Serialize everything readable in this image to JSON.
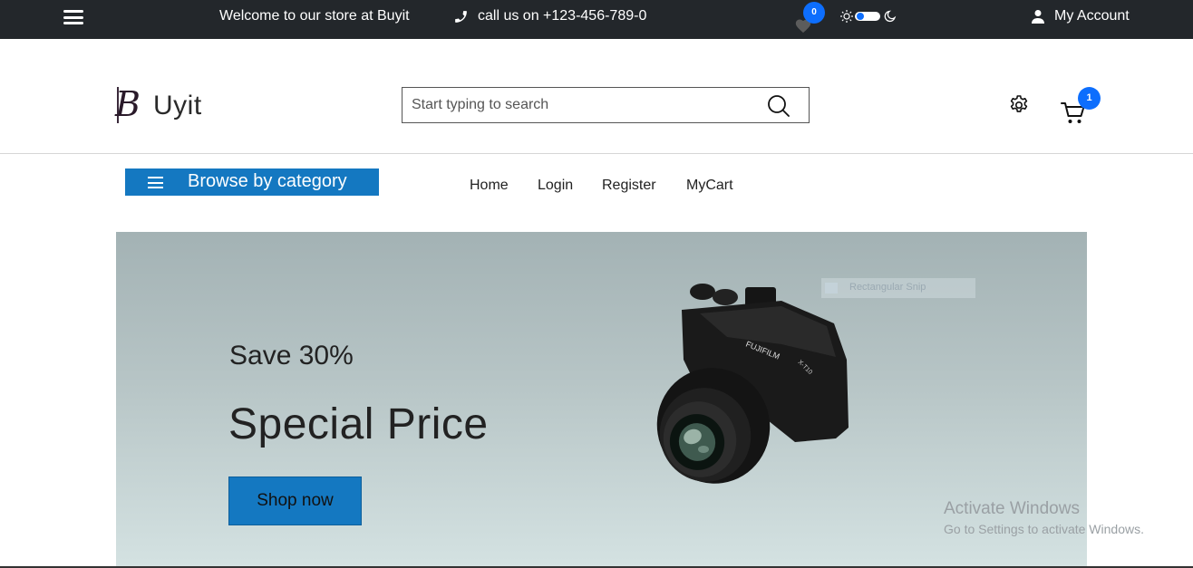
{
  "topbar": {
    "welcome": "Welcome to our store at Buyit",
    "phone": "call us on +123-456-789-0",
    "wishlist_count": "0",
    "account": "My Account",
    "bg_color": "#23272b"
  },
  "header": {
    "logo_letter": "B",
    "logo_text": "Uyit",
    "search_placeholder": "Start typing to search",
    "cart_count": "1"
  },
  "nav": {
    "browse_label": "Browse by category",
    "links": [
      "Home",
      "Login",
      "Register",
      "MyCart"
    ]
  },
  "hero": {
    "save": "Save 30%",
    "title": "Special Price",
    "button": "Shop now",
    "camera_brand": "FUJIFILM",
    "camera_model": "X-T10"
  },
  "overlay": {
    "snip_label": "Rectangular Snip",
    "activate_title": "Activate Windows",
    "activate_sub": "Go to Settings to activate Windows."
  },
  "colors": {
    "accent": "#1478c1",
    "badge": "#0d6efd"
  },
  "icons": [
    "hamburger-icon",
    "phone-icon",
    "heart-icon",
    "sun-icon",
    "moon-icon",
    "user-icon",
    "search-icon",
    "gear-icon",
    "cart-icon"
  ]
}
